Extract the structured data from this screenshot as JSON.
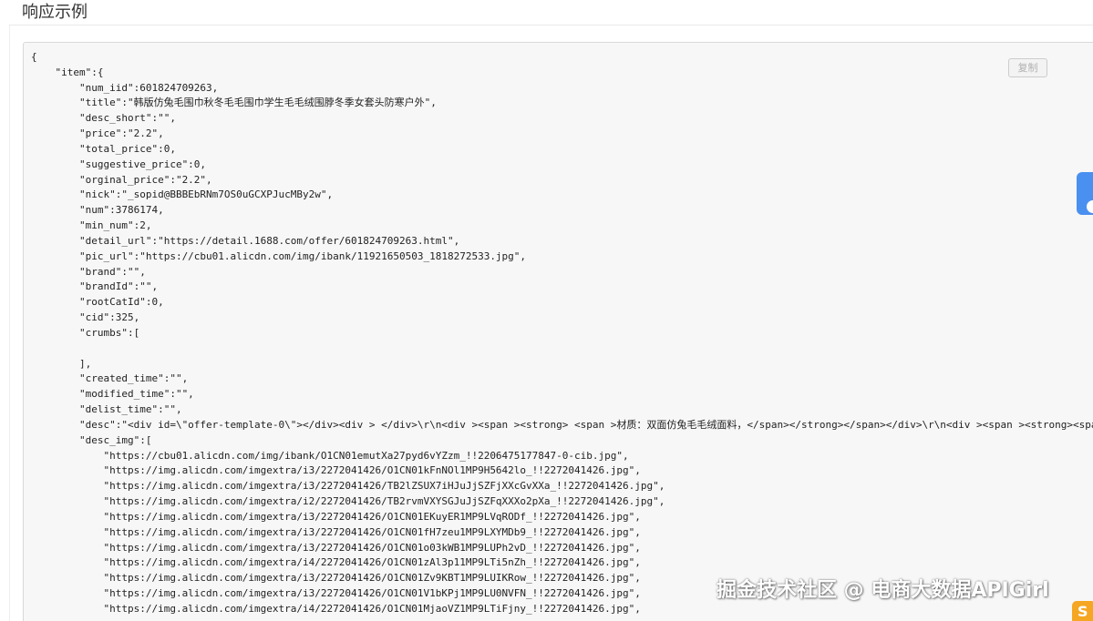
{
  "section": {
    "title": "响应示例"
  },
  "toolbar": {
    "copy_label": "复制"
  },
  "watermark": {
    "text": "掘金技术社区 @ 电商大数据APIGirl"
  },
  "corner_logo": {
    "glyph": "S"
  },
  "colors": {
    "accent": "#4a90f0",
    "code_bg": "#f7f7f7",
    "logo": "#f5a623"
  },
  "code_lines": [
    "{",
    "    \"item\":{",
    "        \"num_iid\":601824709263,",
    "        \"title\":\"韩版仿兔毛围巾秋冬毛毛围巾学生毛毛绒围脖冬季女套头防寒户外\",",
    "        \"desc_short\":\"\",",
    "        \"price\":\"2.2\",",
    "        \"total_price\":0,",
    "        \"suggestive_price\":0,",
    "        \"orginal_price\":\"2.2\",",
    "        \"nick\":\"_sopid@BBBEbRNm7OS0uGCXPJucMBy2w\",",
    "        \"num\":3786174,",
    "        \"min_num\":2,",
    "        \"detail_url\":\"https://detail.1688.com/offer/601824709263.html\",",
    "        \"pic_url\":\"https://cbu01.alicdn.com/img/ibank/11921650503_1818272533.jpg\",",
    "        \"brand\":\"\",",
    "        \"brandId\":\"\",",
    "        \"rootCatId\":0,",
    "        \"cid\":325,",
    "        \"crumbs\":[",
    "",
    "        ],",
    "        \"created_time\":\"\",",
    "        \"modified_time\":\"\",",
    "        \"delist_time\":\"\",",
    "        \"desc\":\"<div id=\\\"offer-template-0\\\"></div><div > </div>\\r\\n<div ><span ><strong> <span >材质：双面仿兔毛毛绒面料，</span></strong></span></div>\\r\\n<div ><span ><strong><span >",
    "        \"desc_img\":[",
    "            \"https://cbu01.alicdn.com/img/ibank/O1CN01emutXa27pyd6vYZzm_!!2206475177847-0-cib.jpg\",",
    "            \"https://img.alicdn.com/imgextra/i3/2272041426/O1CN01kFnNOl1MP9H5642lo_!!2272041426.jpg\",",
    "            \"https://img.alicdn.com/imgextra/i3/2272041426/TB2lZSUX7iHJuJjSZFjXXcGvXXa_!!2272041426.jpg\",",
    "            \"https://img.alicdn.com/imgextra/i2/2272041426/TB2rvmVXYSGJuJjSZFqXXXo2pXa_!!2272041426.jpg\",",
    "            \"https://img.alicdn.com/imgextra/i3/2272041426/O1CN01EKuyER1MP9LVqRODf_!!2272041426.jpg\",",
    "            \"https://img.alicdn.com/imgextra/i3/2272041426/O1CN01fH7zeu1MP9LXYMDb9_!!2272041426.jpg\",",
    "            \"https://img.alicdn.com/imgextra/i3/2272041426/O1CN01o03kWB1MP9LUPh2vD_!!2272041426.jpg\",",
    "            \"https://img.alicdn.com/imgextra/i4/2272041426/O1CN01zAl3p11MP9LTi5nZh_!!2272041426.jpg\",",
    "            \"https://img.alicdn.com/imgextra/i3/2272041426/O1CN01Zv9KBT1MP9LUIKRow_!!2272041426.jpg\",",
    "            \"https://img.alicdn.com/imgextra/i3/2272041426/O1CN01V1bKPj1MP9LU0NVFN_!!2272041426.jpg\",",
    "            \"https://img.alicdn.com/imgextra/i4/2272041426/O1CN01MjaoVZ1MP9LTiFjny_!!2272041426.jpg\","
  ]
}
